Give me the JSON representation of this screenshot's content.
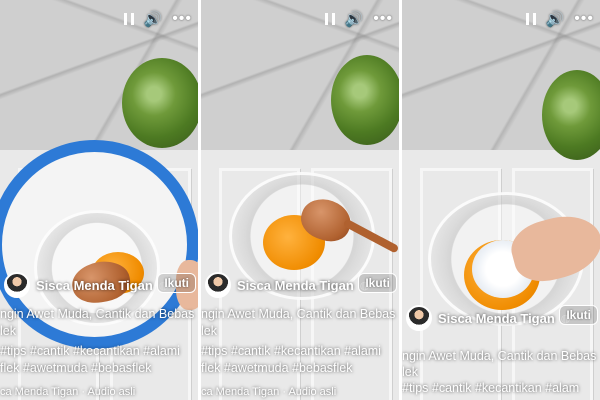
{
  "panels": [
    {
      "author": "Sisca Menda Tigan",
      "follow_label": "Ikuti",
      "caption_lines": [
        "ngin Awet Muda, Cantik dan Bebas",
        "lek",
        "#tips #cantik #kecantikan #alami",
        "flek #awetmuda #bebasflek"
      ],
      "audio": "ca Menda Tigan · Audio asli"
    },
    {
      "author": "Sisca Menda Tigan",
      "follow_label": "Ikuti",
      "caption_lines": [
        "ngin Awet Muda, Cantik dan Bebas",
        "lek",
        "#tips #cantik #kecantikan #alami",
        "flek #awetmuda #bebasflek"
      ],
      "audio": "ca Menda Tigan · Audio asli"
    },
    {
      "author": "Sisca Menda Tigan",
      "follow_label": "Ikuti",
      "caption_lines": [
        "ngin Awet Muda, Cantik dan Bebas",
        "lek",
        "#tips #cantik #kecantikan #alam"
      ],
      "audio": ""
    }
  ],
  "icons": {
    "pause": "pause-icon",
    "volume": "volume-icon",
    "more": "more-icon",
    "globe": "globe-icon"
  },
  "glyphs": {
    "volume": "🔊",
    "more": "•••",
    "globe": "◍"
  }
}
